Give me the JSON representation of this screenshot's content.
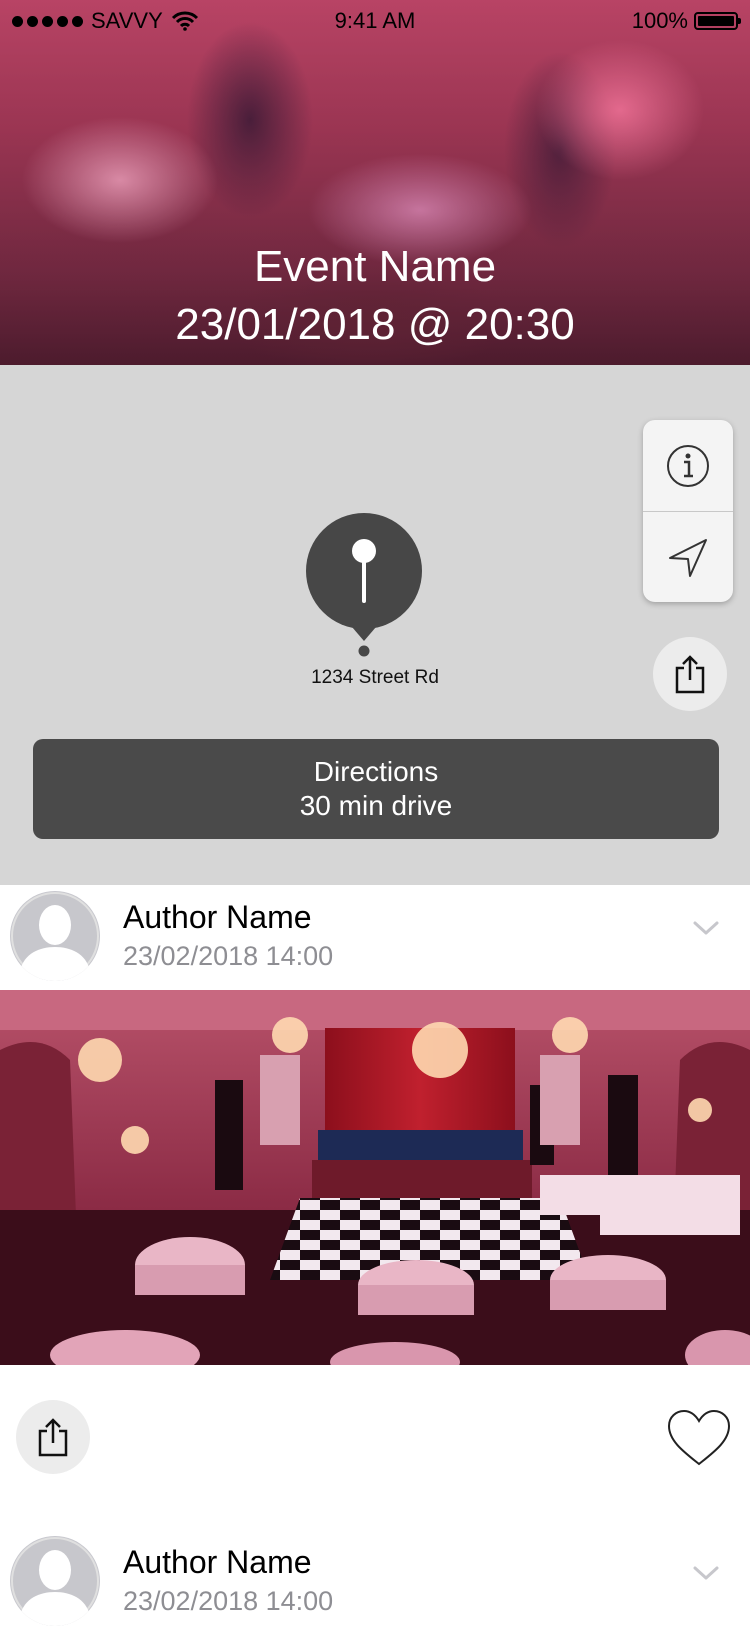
{
  "status_bar": {
    "carrier": "SAVVY",
    "time": "9:41 AM",
    "battery": "100%"
  },
  "event": {
    "title": "Event Name",
    "datetime": "23/01/2018 @ 20:30"
  },
  "map": {
    "address": "1234 Street Rd",
    "directions_label": "Directions",
    "directions_time": "30 min drive"
  },
  "posts": [
    {
      "author": "Author Name",
      "date": "23/02/2018 14:00"
    },
    {
      "author": "Author Name",
      "date": "23/02/2018 14:00"
    }
  ],
  "icons": {
    "info": "info-icon",
    "navigate": "navigation-arrow-icon",
    "share": "share-icon",
    "like": "heart-icon",
    "expand": "chevron-down-icon"
  },
  "colors": {
    "map_bg": "#d6d6d6",
    "button_dark": "#4a4a4a",
    "secondary_text": "#8e8e93"
  }
}
